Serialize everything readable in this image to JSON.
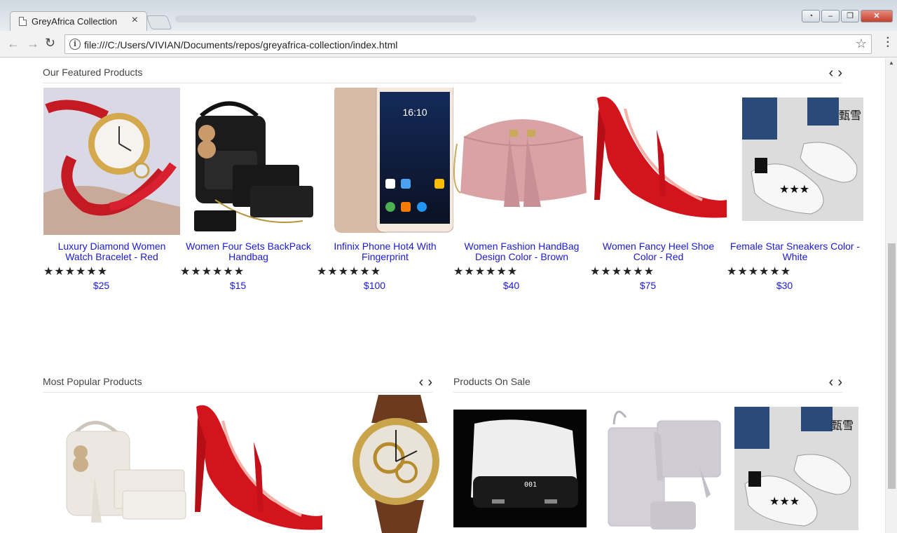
{
  "browser": {
    "tab_title": "GreyAfrica Collection",
    "url": "file:///C:/Users/VIVIAN/Documents/repos/greyafrica-collection/index.html"
  },
  "featured": {
    "title": "Our Featured Products",
    "prev": "‹",
    "next": "›",
    "products": [
      {
        "name": "Luxury Diamond Women Watch Bracelet - Red",
        "price": "$25",
        "rating": "★★★★★★"
      },
      {
        "name": "Women Four Sets BackPack Handbag",
        "price": "$15",
        "rating": "★★★★★★"
      },
      {
        "name": "Infinix Phone Hot4 With Fingerprint",
        "price": "$100",
        "rating": "★★★★★★"
      },
      {
        "name": "Women Fashion HandBag Design Color - Brown",
        "price": "$40",
        "rating": "★★★★★★"
      },
      {
        "name": "Women Fancy Heel Shoe Color - Red",
        "price": "$75",
        "rating": "★★★★★★"
      },
      {
        "name": "Female Star Sneakers Color - White",
        "price": "$30",
        "rating": "★★★★★★"
      }
    ]
  },
  "popular": {
    "title": "Most Popular Products",
    "prev": "‹",
    "next": "›"
  },
  "sale": {
    "title": "Products On Sale",
    "prev": "‹",
    "next": "›"
  },
  "phone_screen": {
    "time": "16:10"
  },
  "power_bank": {
    "display": "001"
  },
  "sneaker_brand": "甄雪",
  "colors": {
    "link": "#1a1ad6",
    "heel_red": "#d4141c",
    "handbag_pink": "#d9a3a6"
  }
}
